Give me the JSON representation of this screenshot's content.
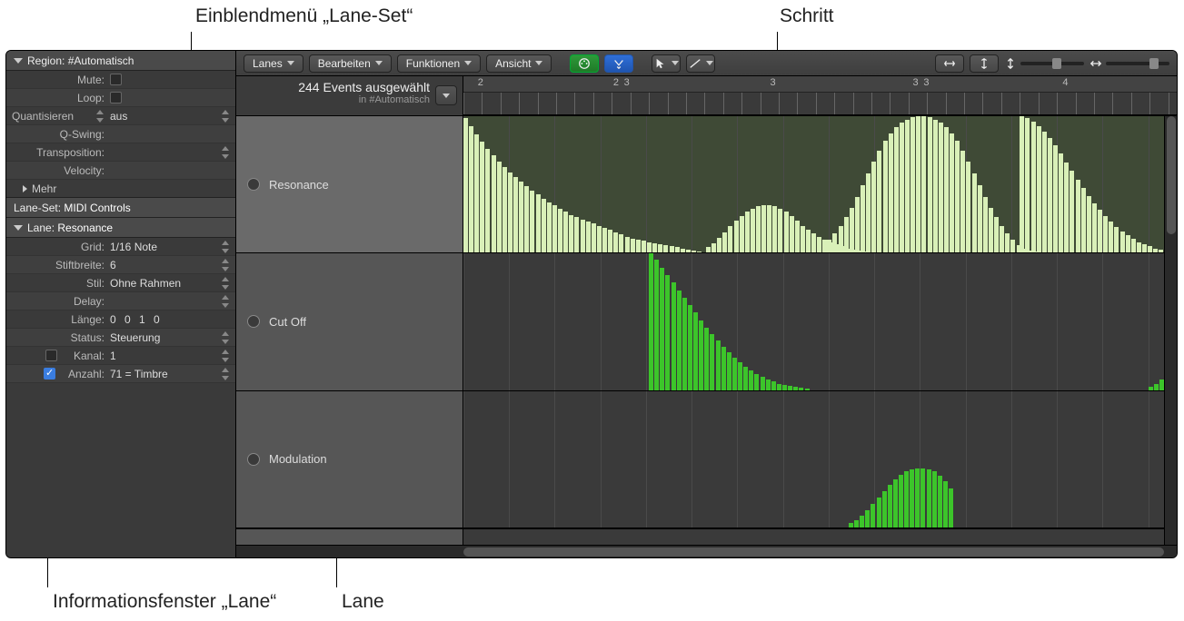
{
  "callouts": {
    "laneset_menu": "Einblendmenü „Lane-Set“",
    "step": "Schritt",
    "lane_info": "Informationsfenster „Lane“",
    "lane": "Lane"
  },
  "inspector": {
    "region_header": "Region:",
    "region_name": "#Automatisch",
    "mute": "Mute:",
    "loop": "Loop:",
    "quantize_label": "Quantisieren",
    "quantize_value": "aus",
    "qswing": "Q-Swing:",
    "transposition": "Transposition:",
    "velocity": "Velocity:",
    "more": "Mehr",
    "laneset_label": "Lane-Set:",
    "laneset_value": "MIDI Controls",
    "lane_header": "Lane:",
    "lane_name": "Resonance",
    "grid_label": "Grid:",
    "grid_value": "1/16 Note",
    "penwidth_label": "Stiftbreite:",
    "penwidth_value": "6",
    "style_label": "Stil:",
    "style_value": "Ohne Rahmen",
    "delay_label": "Delay:",
    "length_label": "Länge:",
    "length_value": "0 0 1   0",
    "status_label": "Status:",
    "status_value": "Steuerung",
    "channel_label": "Kanal:",
    "channel_value": "1",
    "number_label": "Anzahl:",
    "number_value": "71 = Timbre"
  },
  "toolbar": {
    "lanes": "Lanes",
    "edit": "Bearbeiten",
    "functions": "Funktionen",
    "view": "Ansicht"
  },
  "subheader": {
    "line1": "244 Events ausgewählt",
    "line2": "in #Automatisch"
  },
  "ruler": {
    "marks": [
      "2",
      "2",
      "3",
      "3",
      "3",
      "3",
      "4"
    ]
  },
  "lanes": {
    "resonance": "Resonance",
    "cutoff": "Cut Off",
    "modulation": "Modulation"
  },
  "chart_data": [
    {
      "type": "bar",
      "name": "Resonance",
      "color": "#d9f0b8",
      "ylim": [
        0,
        127
      ],
      "segments": [
        {
          "start_pct": 0,
          "values": [
            125,
            118,
            110,
            103,
            97,
            91,
            85,
            80,
            75,
            70,
            66,
            62,
            58,
            54,
            50,
            47,
            44,
            41,
            38,
            35,
            33,
            31,
            29,
            27,
            25,
            23,
            21,
            19,
            17,
            15,
            13,
            12,
            11,
            10,
            9,
            8,
            7,
            6,
            5,
            4,
            3,
            2,
            1
          ]
        },
        {
          "start_pct": 34,
          "values": [
            5,
            9,
            14,
            19,
            25,
            30,
            34,
            38,
            41,
            43,
            44,
            44,
            43,
            41,
            38,
            34,
            30,
            25,
            21,
            18,
            15,
            12,
            10,
            8,
            6,
            4,
            3,
            2,
            1
          ]
        },
        {
          "start_pct": 51,
          "values": [
            12,
            18,
            25,
            33,
            42,
            52,
            63,
            74,
            85,
            95,
            104,
            111,
            117,
            121,
            124,
            126,
            127,
            127,
            126,
            124,
            121,
            117,
            111,
            104,
            95,
            85,
            74,
            63,
            52,
            42,
            33,
            25,
            18,
            12,
            7,
            4,
            2,
            1
          ]
        },
        {
          "start_pct": 78,
          "values": [
            127,
            125,
            122,
            118,
            113,
            107,
            100,
            92,
            84,
            76,
            68,
            60,
            53,
            46,
            40,
            34,
            29,
            24,
            20,
            16,
            13,
            10,
            8,
            6,
            4,
            3,
            2,
            1
          ]
        }
      ]
    },
    {
      "type": "bar",
      "name": "Cut Off",
      "color": "#3cc52a",
      "ylim": [
        0,
        127
      ],
      "segments": [
        {
          "start_pct": 26,
          "values": [
            127,
            121,
            114,
            107,
            100,
            93,
            86,
            79,
            72,
            65,
            58,
            52,
            46,
            40,
            35,
            30,
            26,
            22,
            18,
            15,
            12,
            10,
            8,
            6,
            5,
            4,
            3,
            2,
            1
          ]
        },
        {
          "start_pct": 96,
          "values": [
            3,
            6,
            10,
            15,
            21
          ]
        }
      ]
    },
    {
      "type": "bar",
      "name": "Modulation",
      "color": "#3cc52a",
      "ylim": [
        0,
        127
      ],
      "segments": [
        {
          "start_pct": 54,
          "values": [
            4,
            7,
            11,
            16,
            22,
            28,
            34,
            40,
            45,
            49,
            52,
            54,
            55,
            55,
            54,
            52,
            48,
            43,
            36
          ]
        }
      ]
    }
  ]
}
